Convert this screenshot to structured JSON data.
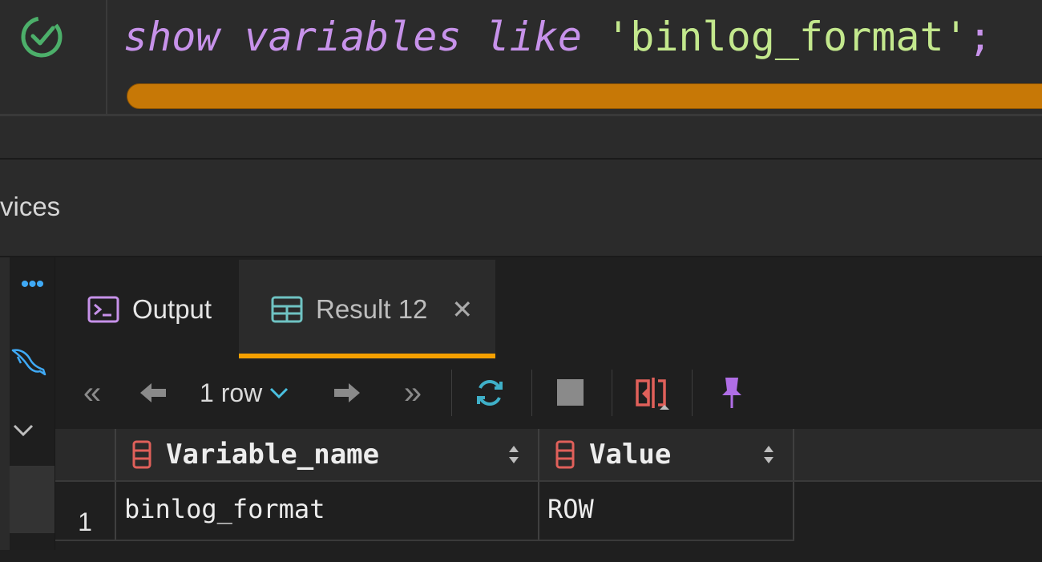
{
  "editor": {
    "sql": {
      "kw1": "show",
      "kw2": "variables",
      "kw3": "like",
      "literal": "'binlog_format'",
      "terminator": ";"
    },
    "status_icon": "check-circle-icon",
    "progress_color": "#c77806"
  },
  "services": {
    "label": "vices"
  },
  "sidebar": {
    "more_label": "•••",
    "icons": [
      "mysql-dolphin-icon",
      "chevron-down-icon"
    ]
  },
  "tabs": [
    {
      "label": "Output",
      "icon": "terminal-icon"
    },
    {
      "label": "Result 12",
      "icon": "table-icon",
      "active": true,
      "close": "✕"
    }
  ],
  "toolbar": {
    "first_page": "«",
    "prev": "previous-arrow-icon",
    "row_count": "1 row",
    "next": "next-arrow-icon",
    "last_page": "»",
    "buttons": [
      "refresh-icon",
      "stop-icon",
      "compare-icon",
      "pin-icon"
    ]
  },
  "grid": {
    "columns": [
      {
        "name": "Variable_name",
        "icon": "column-icon"
      },
      {
        "name": "Value",
        "icon": "column-icon"
      }
    ],
    "rows": [
      {
        "num": "1",
        "cells": [
          "binlog_format",
          "ROW"
        ]
      }
    ]
  },
  "colors": {
    "accent": "#f5a000",
    "keyword": "#c792ea",
    "string": "#c3e88d",
    "check": "#4caf6a",
    "column_icon": "#e0605a",
    "pin": "#b06ee6"
  }
}
